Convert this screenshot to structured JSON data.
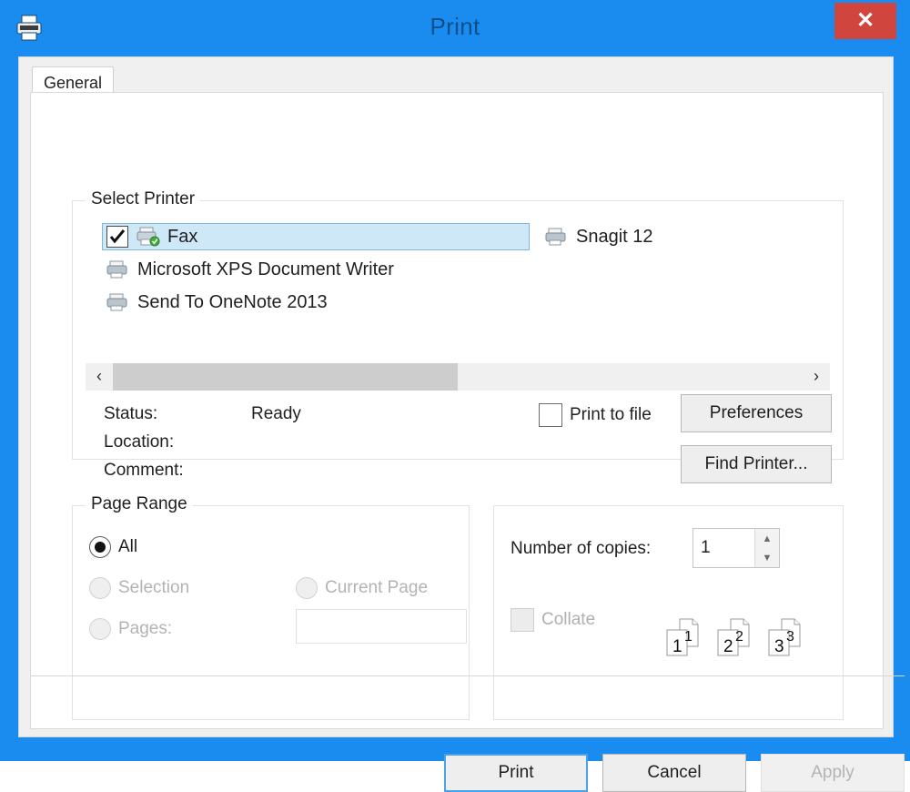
{
  "window": {
    "title": "Print",
    "icon": "printer-icon",
    "close_label": "✕",
    "accent_color": "#1a8cf0",
    "close_color": "#d1453f"
  },
  "tabs": [
    {
      "label": "General",
      "active": true
    }
  ],
  "select_printer": {
    "group_title": "Select Printer",
    "printers": [
      {
        "name": "Fax",
        "selected": true,
        "checked": true,
        "column": 1,
        "row": 0
      },
      {
        "name": "Microsoft XPS Document Writer",
        "selected": false,
        "checked": false,
        "column": 1,
        "row": 1
      },
      {
        "name": "Send To OneNote 2013",
        "selected": false,
        "checked": false,
        "column": 1,
        "row": 2
      },
      {
        "name": "Snagit 12",
        "selected": false,
        "checked": false,
        "column": 2,
        "row": 0
      }
    ],
    "scrollbar": {
      "left_arrow": "‹",
      "right_arrow": "›",
      "thumb_percent": "50"
    },
    "status_label": "Status:",
    "status_value": "Ready",
    "location_label": "Location:",
    "location_value": "",
    "comment_label": "Comment:",
    "comment_value": "",
    "print_to_file_label": "Print to file",
    "print_to_file_checked": false,
    "preferences_label": "Preferences",
    "find_printer_label": "Find Printer..."
  },
  "page_range": {
    "group_title": "Page Range",
    "options": [
      {
        "label": "All",
        "selected": true,
        "disabled": false
      },
      {
        "label": "Selection",
        "selected": false,
        "disabled": true
      },
      {
        "label": "Current Page",
        "selected": false,
        "disabled": true
      },
      {
        "label": "Pages:",
        "selected": false,
        "disabled": true
      }
    ],
    "pages_value": "",
    "pages_placeholder": ""
  },
  "copies": {
    "number_label": "Number of copies:",
    "number_value": "1",
    "spin_up": "▲",
    "spin_down": "▼",
    "collate_label": "Collate",
    "collate_checked": false,
    "collate_preview_pages": [
      "1",
      "1",
      "2",
      "2",
      "3",
      "3"
    ]
  },
  "footer": {
    "print_label": "Print",
    "cancel_label": "Cancel",
    "apply_label": "Apply",
    "apply_disabled": true
  }
}
